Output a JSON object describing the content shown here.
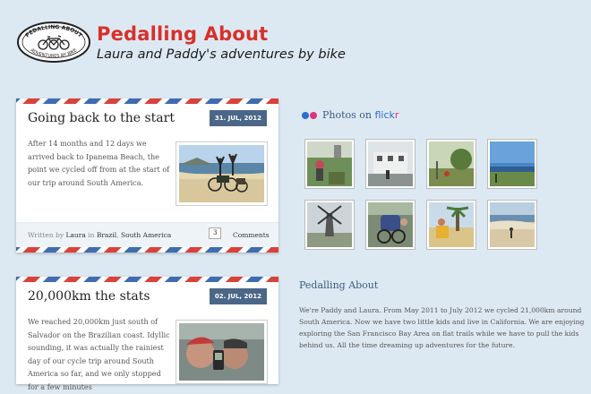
{
  "header": {
    "title": "Pedalling About",
    "tagline": "Laura and Paddy's adventures by bike",
    "logo_text_top": "PEDALLING ABOUT",
    "logo_text_bottom": "ADVENTURES BY BIKE"
  },
  "posts": [
    {
      "title": "Going back to the start",
      "date": "31. JUL, 2012",
      "excerpt": "After 14 months and 12 days we arrived back to Ipanema Beach, the point we cycled off from at the start of our trip around South America.",
      "meta_prefix": "Written by",
      "author": "Laura",
      "meta_in": "in",
      "category1": "Brazil",
      "category2": "South America",
      "comment_count": "3",
      "comments_label": "Comments"
    },
    {
      "title": "20,000km the stats",
      "date": "02. JUL, 2012",
      "excerpt": "We reached 20,000km just south of Salvador on the Brazilian coast. Idyllic sounding, it was actually the rainiest day of our cycle trip around South America so far, and we only stopped for a few minutes"
    }
  ],
  "sidebar": {
    "flickr_prefix": "Photos on",
    "flickr_f": "flick",
    "flickr_r": "r",
    "about_title": "Pedalling About",
    "about_text": "We're Paddy and Laura. From May 2011 to July 2012 we cycled 21,000km around South America. Now we have two little kids and live in California. We are enjoying exploring the San Francisco Bay Area on flat trails while we have to pull the kids behind us. All the time dreaming up adventures for the future."
  },
  "colors": {
    "accent_red": "#d8302a",
    "badge_blue": "#4b6787",
    "sidebar_heading": "#3a5b7f",
    "background": "#dde9f2"
  },
  "icons": [
    "bicycle-logo",
    "flickr-dots-icon"
  ]
}
